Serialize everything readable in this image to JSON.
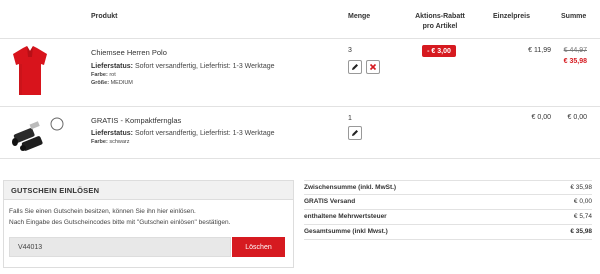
{
  "header": {
    "product": "Produkt",
    "quantity": "Menge",
    "discount_line1": "Aktions-Rabatt",
    "discount_line2": "pro Artikel",
    "unit_price": "Einzelpreis",
    "sum": "Summe"
  },
  "items": [
    {
      "name": "Chiemsee Herren Polo",
      "status_label": "Lieferstatus:",
      "status_value": "Sofort versandfertig, Lieferfrist: 1-3 Werktage",
      "color_label": "Farbe:",
      "color_value": "rot",
      "size_label": "Größe:",
      "size_value": "MEDIUM",
      "quantity": "3",
      "discount": "- € 3,00",
      "unit_price": "€ 11,99",
      "old_sum": "€ 44,97",
      "sum": "€ 35,98"
    },
    {
      "name": "GRATIS - Kompaktfernglas",
      "status_label": "Lieferstatus:",
      "status_value": "Sofort versandfertig, Lieferfrist: 1-3 Werktage",
      "color_label": "Farbe:",
      "color_value": "schwarz",
      "quantity": "1",
      "unit_price": "€ 0,00",
      "sum": "€ 0,00"
    }
  ],
  "coupon": {
    "title": "GUTSCHEIN EINLÖSEN",
    "text1": "Falls Sie einen Gutschein besitzen, können Sie ihn hier einlösen.",
    "text2": "Nach Eingabe des Gutscheincodes bitte mit \"Gutschein einlösen\" bestätigen.",
    "code": "V44013",
    "button": "Löschen"
  },
  "summary": [
    {
      "label": "Zwischensumme (inkl. MwSt.)",
      "value": "€ 35,98"
    },
    {
      "label": "GRATIS Versand",
      "value": "€ 0,00"
    },
    {
      "label": "enthaltene Mehrwertsteuer",
      "value": "€ 5,74"
    },
    {
      "label": "Gesamtsumme (inkl Mwst.)",
      "value": "€ 35,98"
    }
  ],
  "colors": {
    "accent": "#d61a20",
    "polo": "#d8141c"
  }
}
